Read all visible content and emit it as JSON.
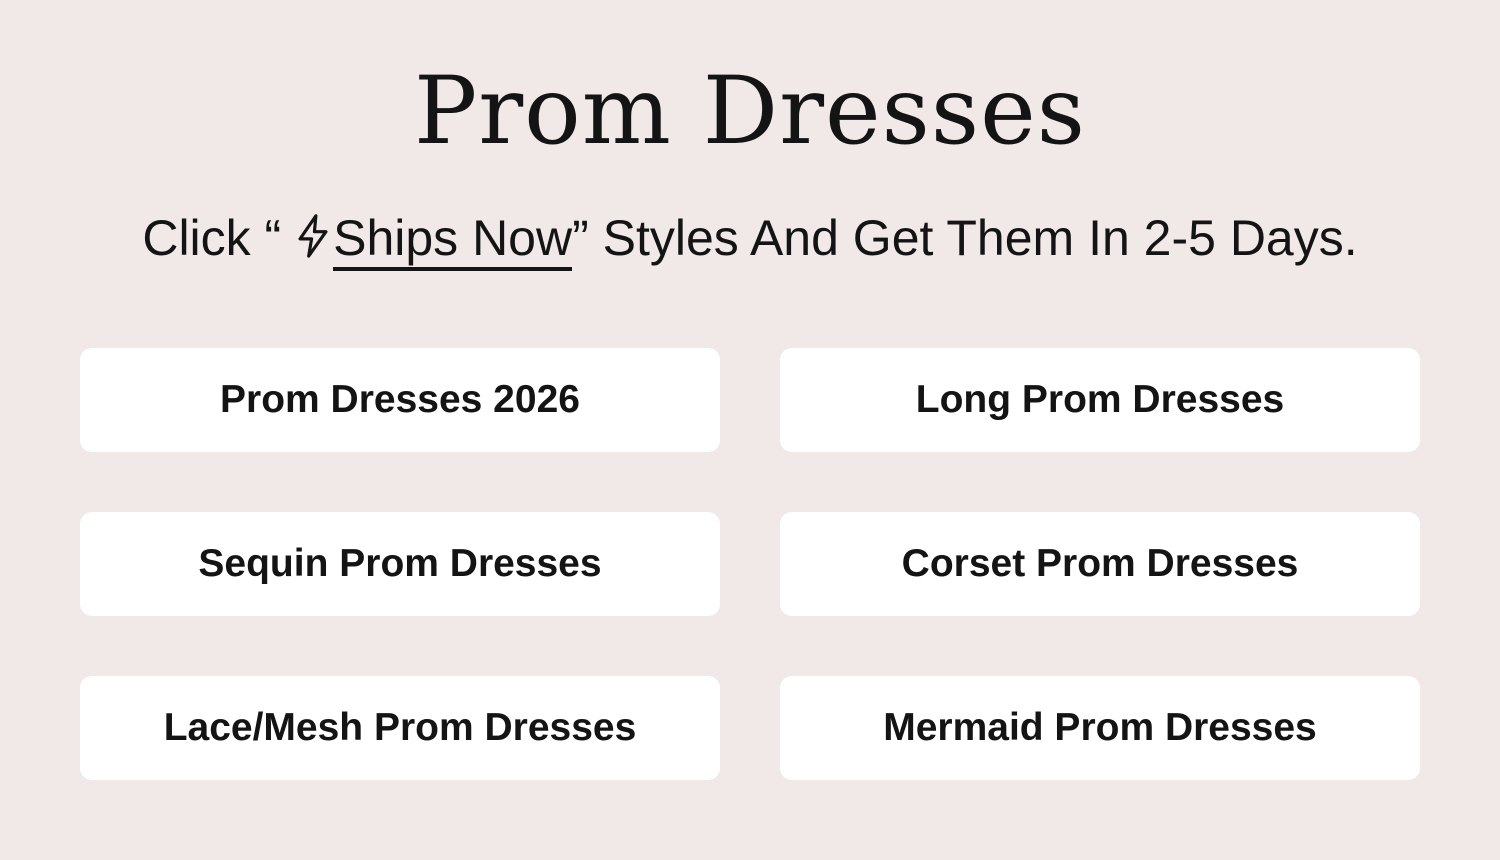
{
  "header": {
    "title": "Prom Dresses"
  },
  "promo": {
    "prefix": "Click “ ",
    "icon": "lightning-bolt-icon",
    "link_text": "Ships Now",
    "suffix": "” Styles And Get Them In 2-5 Days."
  },
  "categories": [
    {
      "label": "Prom Dresses 2026"
    },
    {
      "label": "Long Prom Dresses"
    },
    {
      "label": "Sequin Prom Dresses"
    },
    {
      "label": "Corset Prom Dresses"
    },
    {
      "label": "Lace/Mesh Prom Dresses"
    },
    {
      "label": "Mermaid Prom Dresses"
    }
  ],
  "colors": {
    "background": "#f1e9e7",
    "button_background": "#ffffff",
    "text": "#141414"
  }
}
